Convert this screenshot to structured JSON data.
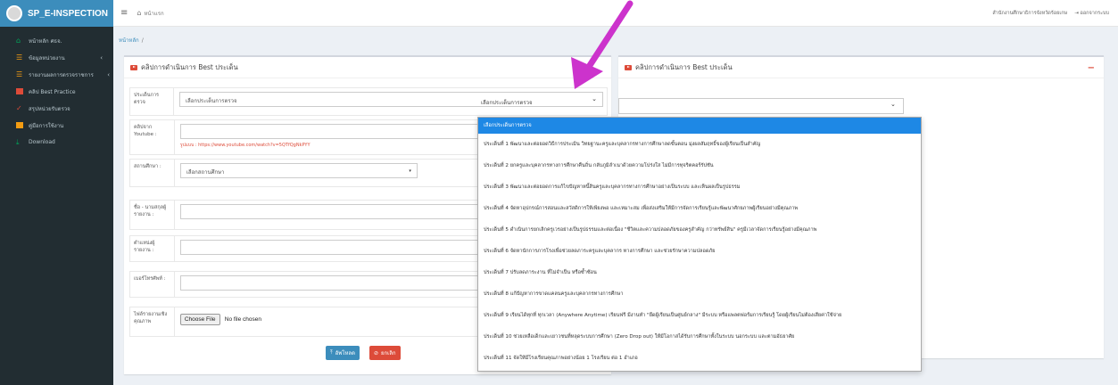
{
  "brand": {
    "title": "SP_E-INSPECTION"
  },
  "topbar": {
    "home_label": "หน้าแรก",
    "org_label": "สำนักงานศึกษาธิการจังหวัดร้อยเกษ",
    "logout_label": "ออกจากระบบ"
  },
  "sidebar": {
    "items": [
      {
        "label": "หน้าหลัก ศธจ.",
        "icon": "home-icon"
      },
      {
        "label": "ข้อมูลหน่วยงาน",
        "icon": "list-icon",
        "chevron": "‹"
      },
      {
        "label": "รายงานผลการตรวจราชการ",
        "icon": "list-icon",
        "chevron": "‹"
      },
      {
        "label": "คลิป Best Practice",
        "icon": "video-icon"
      },
      {
        "label": "สรุปหน่วยรับตรวจ",
        "icon": "check-icon"
      },
      {
        "label": "คู่มือการใช้งาน",
        "icon": "book-icon"
      },
      {
        "label": "Download",
        "icon": "download-icon"
      }
    ]
  },
  "breadcrumb": {
    "home": "หน้าหลัก",
    "sep": "/"
  },
  "left_card": {
    "title": "คลิปการดำเนินการ Best ประเด็น",
    "fields": {
      "issue_label": "ประเด็นการตรวจ",
      "issue_value": "เลือกประเด็นการตรวจ",
      "clip_label": "คลิปจาก Youtube :",
      "clip_hint": "รูปแบบ : https://www.youtube.com/watch?v=5QTfQgNkPYY",
      "school_label": "สถานศึกษา :",
      "school_value": "เลือกสถานศึกษา",
      "name_label": "ชื่อ - นามสกุลผู้รายงาน :",
      "position_label": "ตำแหน่งผู้รายงาน :",
      "phone_label": "เบอร์โทรศัพท์ :",
      "file_label": "ไฟล์รายงานเชิงคุณภาพ",
      "file_button": "Choose File",
      "file_status": "No file chosen"
    },
    "buttons": {
      "upload": "อัพโหลด",
      "cancel": "ยกเลิก"
    }
  },
  "right_card": {
    "title": "คลิปการดำเนินการ Best ประเด็น",
    "select_value": "เลือกประเด็นการตรวจ"
  },
  "dropdown": {
    "options": [
      "เลือกประเด็นการตรวจ",
      "ประเด็นที่ 1 พัฒนาและต่อยอดวิธีการประเมิน วิทยฐานะครูและบุคลากรทางการศึกษาลดขั้นตอน มุ่งผลสัมฤทธิ์ของผู้เรียนเป็นสำคัญ",
      "ประเด็นที่ 2 ยกครูและบุคลากรทางการศึกษาคืนถิ่น กลับภูมิลำเนาด้วยความโปร่งใส ไม่มีการทุจริตคอร์รัปชัน",
      "ประเด็นที่ 3 พัฒนาและต่อยอดการแก้ไขปัญหาหนี้สินครูและบุคลากรทางการศึกษาอย่างเป็นระบบ และเห็นผลเป็นรูปธรรม",
      "ประเด็นที่ 4 จัดหาอุปกรณ์การสอนและสวัสดิการให้เพียงพอ และเหมาะสม เพื่อส่งเสริมให้มีการจัดการเรียนรู้และพัฒนาศักยภาพผู้เรียนอย่างมีคุณภาพ",
      "ประเด็นที่ 5 ดำเนินการยกเลิกครูเวรอย่างเป็นรูปธรรมและต่อเนื่อง \"ชีวิตและความปลอดภัยของครูสำคัญ กว่าทรัพย์สิน\" ครูมีเวลาจัดการเรียนรู้อย่างมีคุณภาพ",
      "ประเด็นที่ 6 จัดหานักการภารโรงเพื่อช่วยลดภาระครูและบุคลากร ทางการศึกษา และช่วยรักษาความปลอดภัย",
      "ประเด็นที่ 7 ปรับลดภาระงาน ที่ไม่จำเป็น หรือซ้ำซ้อน",
      "ประเด็นที่ 8 แก้ปัญหาการขาดแคลนครูและบุคลากรทางการศึกษา",
      "ประเด็นที่ 9 เรียนได้ทุกที่ ทุกเวลา (Anywhere Anytime) เรียนฟรี มีงานทำ \"ยึดผู้เรียนเป็นศูนย์กลาง\" มีระบบ หรือแพลตฟอร์มการเรียนรู้ โดยผู้เรียนไม่ต้องเสียค่าใช้จ่าย",
      "ประเด็นที่ 10 ช่วยเหลือเด็กและเยาวชนที่หลุดระบบการศึกษา (Zero Drop out) ให้มีโอกาสได้รับการศึกษาทั้งในระบบ นอกระบบ และตามอัธยาศัย",
      "ประเด็นที่ 11 จัดให้มีโรงเรียนคุณภาพอย่างน้อย 1 โรงเรียน ต่อ 1 อำเภอ"
    ]
  },
  "colors": {
    "sidebar": "#222d32",
    "brand": "#3c8dbc",
    "accent": "#1e88e5",
    "danger": "#dd4b39",
    "arrow": "#cc33cc"
  }
}
